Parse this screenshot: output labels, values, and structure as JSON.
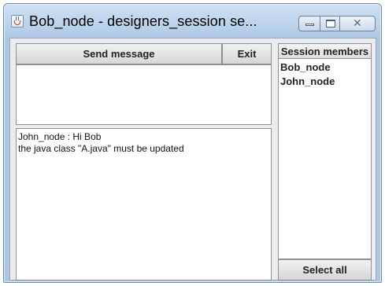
{
  "window": {
    "title": "Bob_node - designers_session se...",
    "icon": "java-coffee-cup-icon"
  },
  "toolbar": {
    "send_label": "Send message",
    "exit_label": "Exit"
  },
  "input": {
    "value": ""
  },
  "messages": [
    "John_node : Hi Bob",
    "the java class \"A.java\" must be updated"
  ],
  "members": {
    "header": "Session members",
    "items": [
      "Bob_node",
      "John_node"
    ],
    "select_all_label": "Select all"
  },
  "colors": {
    "titlebar": "#b9d1ea",
    "client_background": "#ececec",
    "text_area_background": "#ffffff"
  }
}
